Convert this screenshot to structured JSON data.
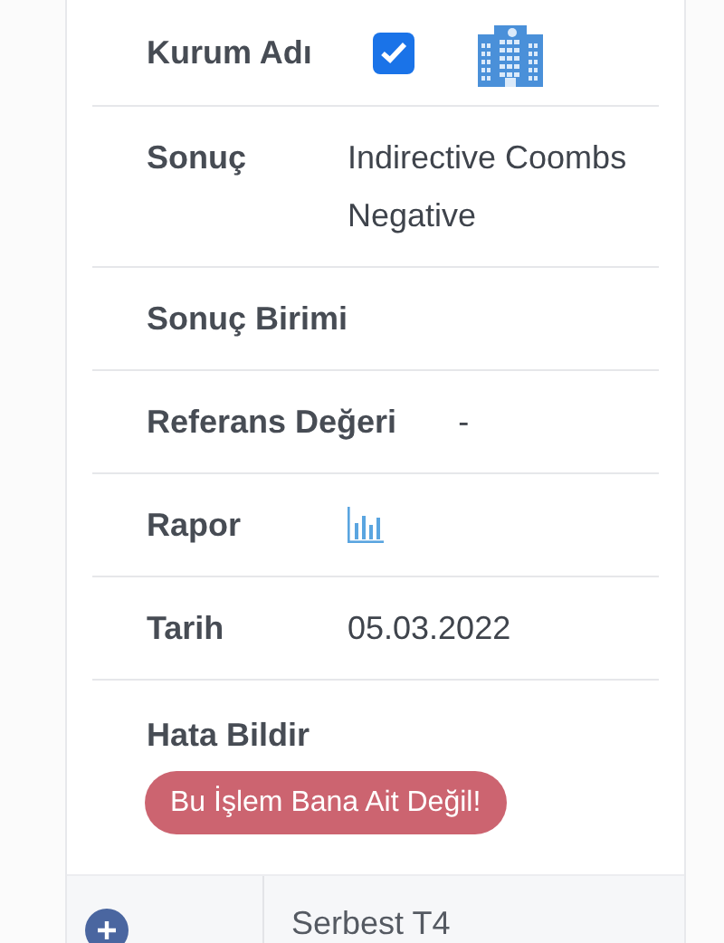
{
  "rows": [
    {
      "kind": "checkbox",
      "label": "Kurum Adı",
      "checked": true
    },
    {
      "kind": "text",
      "label": "Sonuç",
      "value": "Indirective Coombs Negative"
    },
    {
      "kind": "text",
      "label": "Sonuç Birimi"
    },
    {
      "kind": "text",
      "label": "Referans Değeri",
      "value": "-"
    },
    {
      "kind": "chart",
      "label": "Rapor"
    },
    {
      "kind": "text",
      "label": "Tarih",
      "value": "05.03.2022"
    },
    {
      "kind": "button",
      "label": "Hata Bildir",
      "button": "Bu İşlem Bana Ait Değil!"
    }
  ],
  "next_record": {
    "title": "Serbest T4",
    "expanded": false
  }
}
